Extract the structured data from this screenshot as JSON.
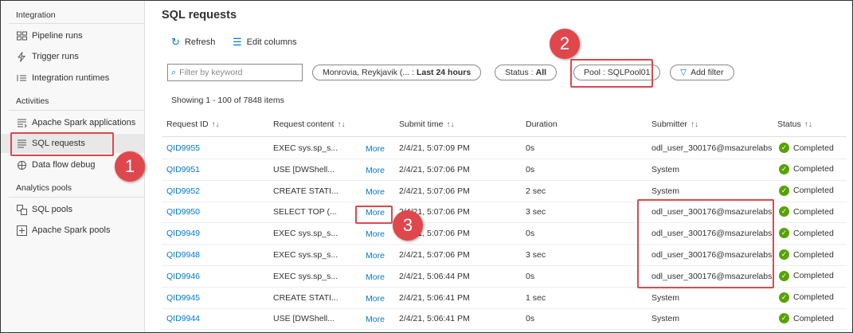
{
  "sidebar": {
    "sections": [
      {
        "title": "Integration",
        "items": [
          {
            "label": "Pipeline runs",
            "icon": "pipeline-runs-icon"
          },
          {
            "label": "Trigger runs",
            "icon": "trigger-icon"
          },
          {
            "label": "Integration runtimes",
            "icon": "integration-runtime-icon"
          }
        ]
      },
      {
        "title": "Activities",
        "items": [
          {
            "label": "Apache Spark applications",
            "icon": "spark-applications-icon"
          },
          {
            "label": "SQL requests",
            "icon": "sql-requests-icon"
          },
          {
            "label": "Data flow debug",
            "icon": "data-flow-debug-icon"
          }
        ]
      },
      {
        "title": "Analytics pools",
        "items": [
          {
            "label": "SQL pools",
            "icon": "sql-pools-icon"
          },
          {
            "label": "Apache Spark pools",
            "icon": "spark-pools-icon"
          }
        ]
      }
    ],
    "active": "SQL requests"
  },
  "main": {
    "title": "SQL requests",
    "toolbar": {
      "refresh": "Refresh",
      "edit_columns": "Edit columns"
    },
    "filter_placeholder": "Filter by keyword",
    "pills": {
      "time_prefix": "Monrovia, Reykjavik (... :",
      "time_value": "Last 24 hours",
      "status_prefix": "Status :",
      "status_value": "All",
      "pool": "Pool : SQLPool01",
      "add_filter": "Add filter"
    },
    "showing": "Showing 1 - 100 of 7848 items",
    "columns": [
      "Request ID",
      "Request content",
      "Submit time",
      "Duration",
      "Submitter",
      "Status"
    ],
    "more_label": "More",
    "rows": [
      {
        "id": "QID9955",
        "content": "EXEC sys.sp_s...",
        "time": "2/4/21, 5:07:09 PM",
        "duration": "0s",
        "submitter": "odl_user_300176@msazurelabs",
        "status": "Completed"
      },
      {
        "id": "QID9951",
        "content": "USE [DWShell...",
        "time": "2/4/21, 5:07:06 PM",
        "duration": "0s",
        "submitter": "System",
        "status": "Completed"
      },
      {
        "id": "QID9952",
        "content": "CREATE STATI...",
        "time": "2/4/21, 5:07:06 PM",
        "duration": "2 sec",
        "submitter": "System",
        "status": "Completed"
      },
      {
        "id": "QID9950",
        "content": "SELECT TOP (...",
        "time": "2/4/21, 5:07:06 PM",
        "duration": "3 sec",
        "submitter": "odl_user_300176@msazurelabs",
        "status": "Completed"
      },
      {
        "id": "QID9949",
        "content": "EXEC sys.sp_s...",
        "time": "2/4/21, 5:07:06 PM",
        "duration": "0s",
        "submitter": "odl_user_300176@msazurelabs",
        "status": "Completed"
      },
      {
        "id": "QID9948",
        "content": "EXEC sys.sp_s...",
        "time": "2/4/21, 5:07:06 PM",
        "duration": "3 sec",
        "submitter": "odl_user_300176@msazurelabs",
        "status": "Completed"
      },
      {
        "id": "QID9946",
        "content": "EXEC sys.sp_s...",
        "time": "2/4/21, 5:06:44 PM",
        "duration": "0s",
        "submitter": "odl_user_300176@msazurelabs",
        "status": "Completed"
      },
      {
        "id": "QID9945",
        "content": "CREATE STATI...",
        "time": "2/4/21, 5:06:41 PM",
        "duration": "1 sec",
        "submitter": "System",
        "status": "Completed"
      },
      {
        "id": "QID9944",
        "content": "USE [DWShell...",
        "time": "2/4/21, 5:06:41 PM",
        "duration": "0s",
        "submitter": "System",
        "status": "Completed"
      }
    ]
  },
  "callouts": [
    "1",
    "2",
    "3"
  ],
  "colors": {
    "accent": "#0078d4",
    "highlight": "#e0474c",
    "success": "#57a300"
  }
}
